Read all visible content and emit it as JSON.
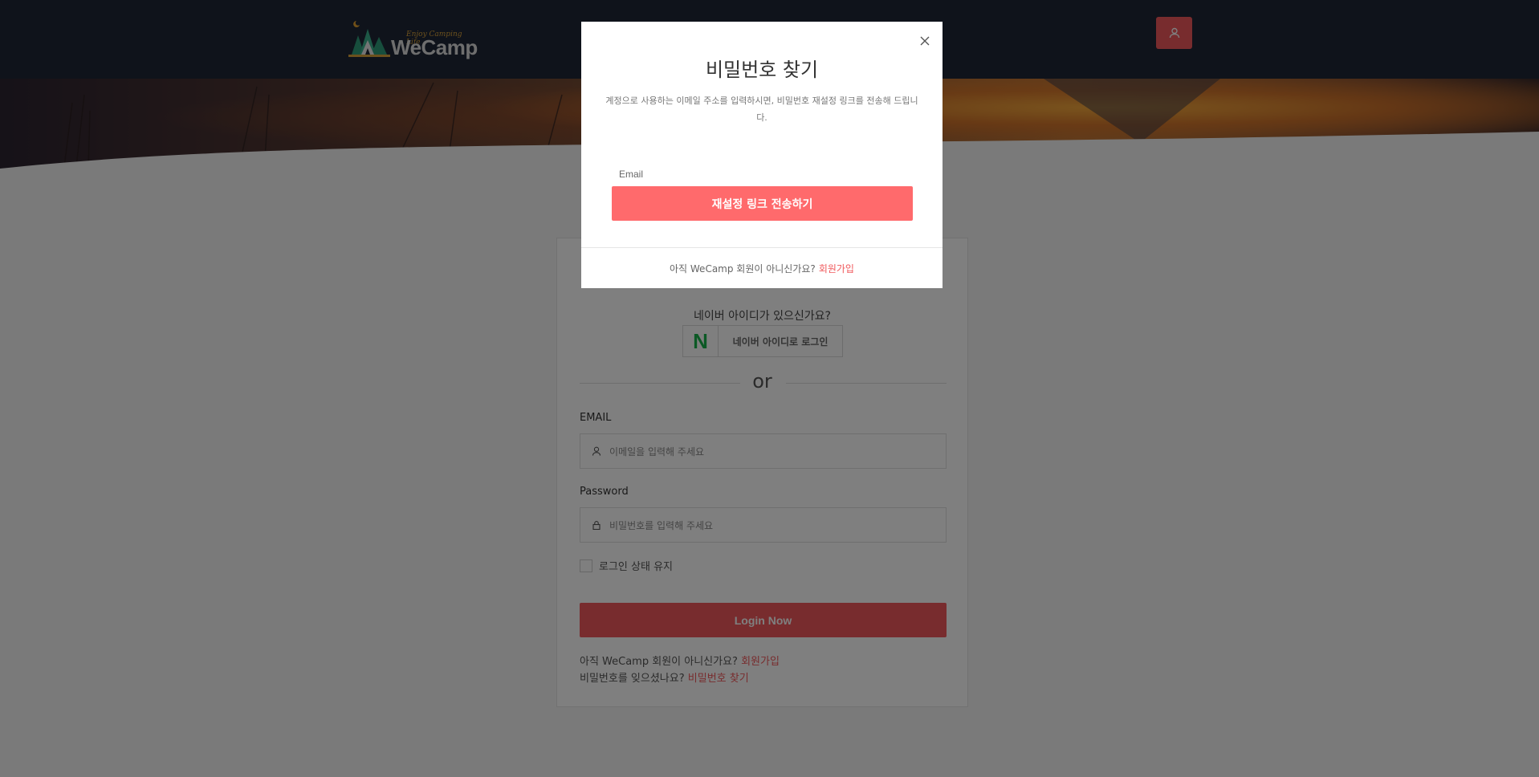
{
  "header": {
    "logo_tagline": "Enjoy Camping Life",
    "logo_text": "WeCamp",
    "user_icon": "user-icon"
  },
  "login": {
    "naver_question": "네이버 아이디가 있으신가요?",
    "naver_logo": "N",
    "naver_button": "네이버 아이디로 로그인",
    "or_text": "or",
    "email_label": "EMAIL",
    "email_placeholder": "이메일을 입력해 주세요",
    "password_label": "Password",
    "password_placeholder": "비밀번호를 입력해 주세요",
    "remember_label": "로그인 상태 유지",
    "login_button": "Login Now",
    "signup_prompt": "아직 WeCamp 회원이 아니신가요?",
    "signup_link": "회원가입",
    "forgot_prompt": "비밀번호를 잊으셨나요?",
    "forgot_link": "비밀번호 찾기"
  },
  "modal": {
    "title": "비밀번호 찾기",
    "description": "계정으로 사용하는 이메일 주소를 입력하시면, 비밀번호 재설정 링크를 전송해 드립니다.",
    "email_placeholder": "Email",
    "submit_button": "재설정 링크 전송하기",
    "footer_prompt": "아직 WeCamp 회원이 아니신가요?",
    "footer_link": "회원가입"
  },
  "colors": {
    "accent": "#f0595c",
    "header_bg": "#1f2636"
  }
}
